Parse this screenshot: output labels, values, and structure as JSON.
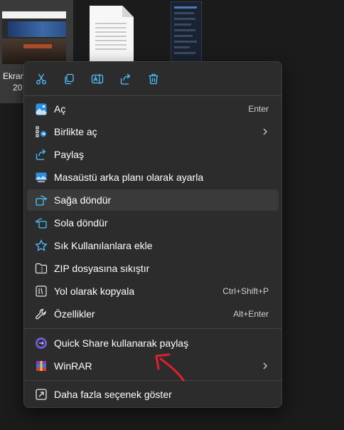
{
  "desktop": {
    "selected_file_caption_line1": "Ekran",
    "selected_file_caption_line2": "20"
  },
  "menu": {
    "toolbar": [
      "cut-icon",
      "copy-icon",
      "rename-icon",
      "share-icon",
      "delete-icon"
    ],
    "items": [
      {
        "label": "Aç",
        "shortcut": "Enter"
      },
      {
        "label": "Birlikte aç",
        "submenu": true
      },
      {
        "label": "Paylaş"
      },
      {
        "label": "Masaüstü arka planı olarak ayarla"
      },
      {
        "label": "Sağa döndür"
      },
      {
        "label": "Sola döndür"
      },
      {
        "label": "Sık Kullanılanlara ekle"
      },
      {
        "label": "ZIP dosyasına sıkıştır"
      },
      {
        "label": "Yol olarak kopyala",
        "shortcut": "Ctrl+Shift+P"
      },
      {
        "label": "Özellikler",
        "shortcut": "Alt+Enter"
      },
      {
        "label": "Quick Share kullanarak paylaş"
      },
      {
        "label": "WinRAR",
        "submenu": true
      },
      {
        "label": "Daha fazla seçenek göster"
      }
    ]
  },
  "colors": {
    "menu_bg": "#2c2c2c",
    "accent_blue": "#4cc2ff",
    "annotation_red": "#e0202a"
  }
}
